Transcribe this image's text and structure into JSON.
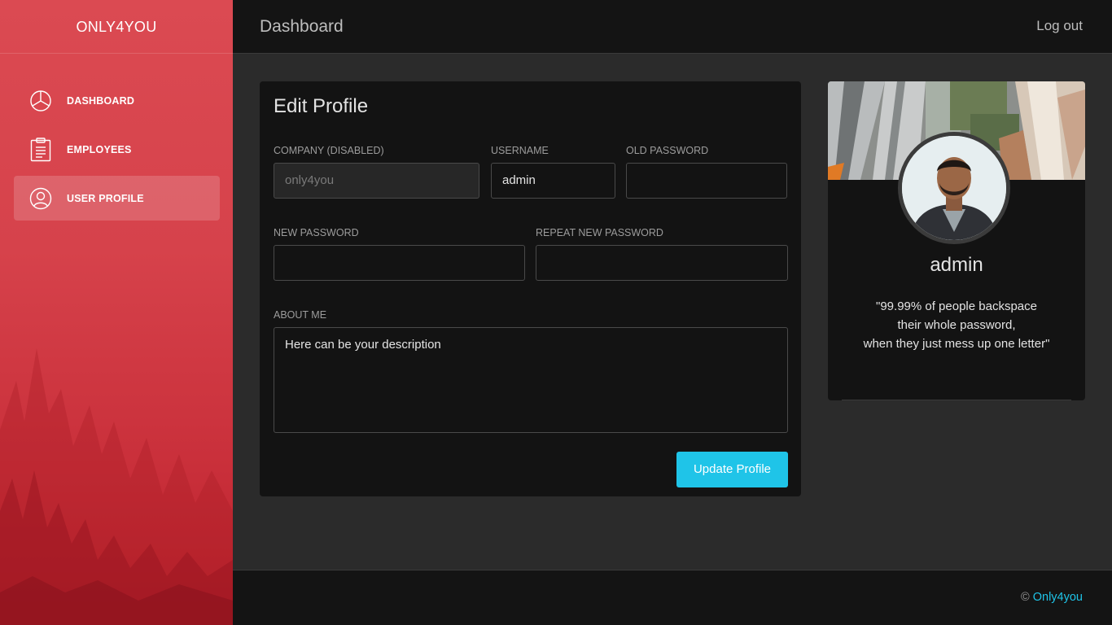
{
  "sidebar": {
    "brand": "ONLY4YOU",
    "items": [
      {
        "label": "DASHBOARD",
        "icon": "pie-chart-icon"
      },
      {
        "label": "EMPLOYEES",
        "icon": "clipboard-icon"
      },
      {
        "label": "USER PROFILE",
        "icon": "user-icon",
        "active": true
      }
    ]
  },
  "topbar": {
    "title": "Dashboard",
    "logout": "Log out"
  },
  "form": {
    "title": "Edit Profile",
    "company_label": "COMPANY (DISABLED)",
    "company_value": "only4you",
    "username_label": "USERNAME",
    "username_value": "admin",
    "old_password_label": "OLD PASSWORD",
    "old_password_value": "",
    "new_password_label": "NEW PASSWORD",
    "new_password_value": "",
    "repeat_password_label": "REPEAT NEW PASSWORD",
    "repeat_password_value": "",
    "about_label": "ABOUT ME",
    "about_value": "Here can be your description",
    "submit": "Update Profile"
  },
  "profile": {
    "name": "admin",
    "quote_line1": "\"99.99% of people backspace",
    "quote_line2": "their whole password,",
    "quote_line3": "when they just mess up one letter\""
  },
  "footer": {
    "copyright": "©",
    "brand": "Only4you"
  },
  "colors": {
    "accent": "#1fc4e8",
    "sidebar": "#d6424b",
    "panel": "#131313"
  }
}
